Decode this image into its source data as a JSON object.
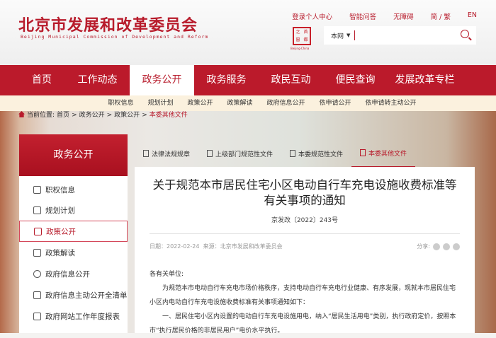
{
  "header": {
    "title": "北京市发展和改革委员会",
    "subtitle": "Beijing Municipal Commission of Development and Reform",
    "links": [
      "登录个人中心",
      "智能问答",
      "无障碍",
      "简 / 繁",
      "EN"
    ],
    "seal_chars": [
      "首",
      "之",
      "窗",
      "都"
    ],
    "seal_caption": "Beijing·China",
    "search": {
      "scope": "本网",
      "value": ""
    }
  },
  "nav": {
    "items": [
      "首页",
      "工作动态",
      "政务公开",
      "政务服务",
      "政民互动",
      "便民查询",
      "发展改革专栏"
    ],
    "active": 2
  },
  "subnav": [
    "职权信息",
    "规划计划",
    "政策公开",
    "政策解读",
    "政府信息公开",
    "依申请公开",
    "依申请转主动公开"
  ],
  "breadcrumb": {
    "label": "当前位置:",
    "items": [
      "首页",
      ">",
      "政务公开",
      ">",
      "政策公开",
      ">",
      "本委其他文件"
    ]
  },
  "sidebar": {
    "title": "政务公开",
    "items": [
      "职权信息",
      "规划计划",
      "政策公开",
      "政策解读",
      "政府信息公开",
      "政府信息主动公开全清单",
      "政府网站工作年度报表"
    ],
    "active": 2
  },
  "tabs": [
    "法律法规规章",
    "上级部门规范性文件",
    "本委规范性文件",
    "本委其他文件"
  ],
  "article": {
    "title": "关于规范本市居民住宅小区电动自行车充电设施收费标准等有关事项的通知",
    "doc_no": "京发改〔2022〕243号",
    "date": "日期：2022-02-24",
    "source": "来源：北京市发展和改革委员会",
    "share": "分享:",
    "salutation": "各有关单位:",
    "p1": "为规范本市电动自行车充电市场价格秩序，支持电动自行车充电行业健康、有序发展，现就本市居民住宅小区内电动自行车充电设施收费标准有关事项通知如下：",
    "p2": "一、居民住宅小区内设置的电动自行车充电设施用电，纳入“居民生活用电”类别，执行政府定价，按照本市“执行居民价格的非居民用户”电价水平执行。"
  }
}
